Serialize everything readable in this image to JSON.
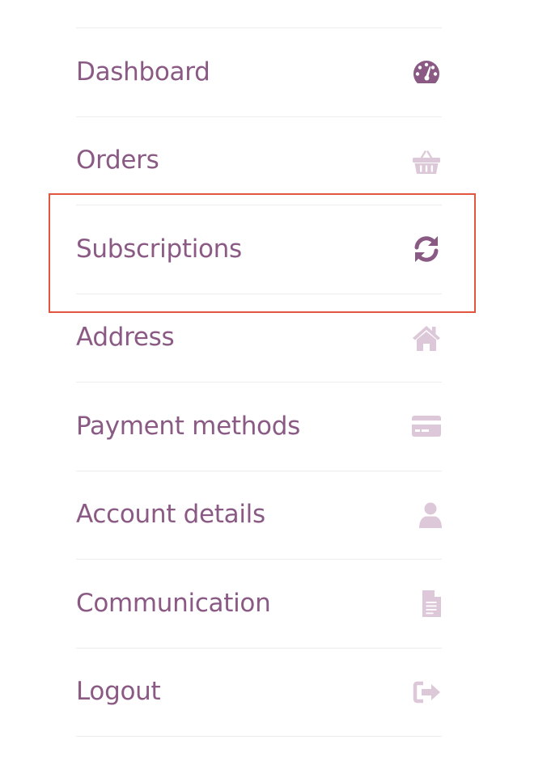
{
  "account_nav": {
    "accent_color": "#8a5a84",
    "muted_icon_color": "#dcc8d8",
    "items": [
      {
        "label": "Dashboard",
        "icon": "tachometer-icon",
        "emphasized": true
      },
      {
        "label": "Orders",
        "icon": "basket-icon",
        "emphasized": false
      },
      {
        "label": "Subscriptions",
        "icon": "refresh-icon",
        "emphasized": true
      },
      {
        "label": "Address",
        "icon": "home-icon",
        "emphasized": false
      },
      {
        "label": "Payment methods",
        "icon": "credit-card-icon",
        "emphasized": false
      },
      {
        "label": "Account details",
        "icon": "user-icon",
        "emphasized": false
      },
      {
        "label": "Communication",
        "icon": "document-icon",
        "emphasized": false
      },
      {
        "label": "Logout",
        "icon": "sign-out-icon",
        "emphasized": false
      }
    ]
  },
  "highlight": {
    "target": "Subscriptions",
    "color": "#e2553f"
  }
}
